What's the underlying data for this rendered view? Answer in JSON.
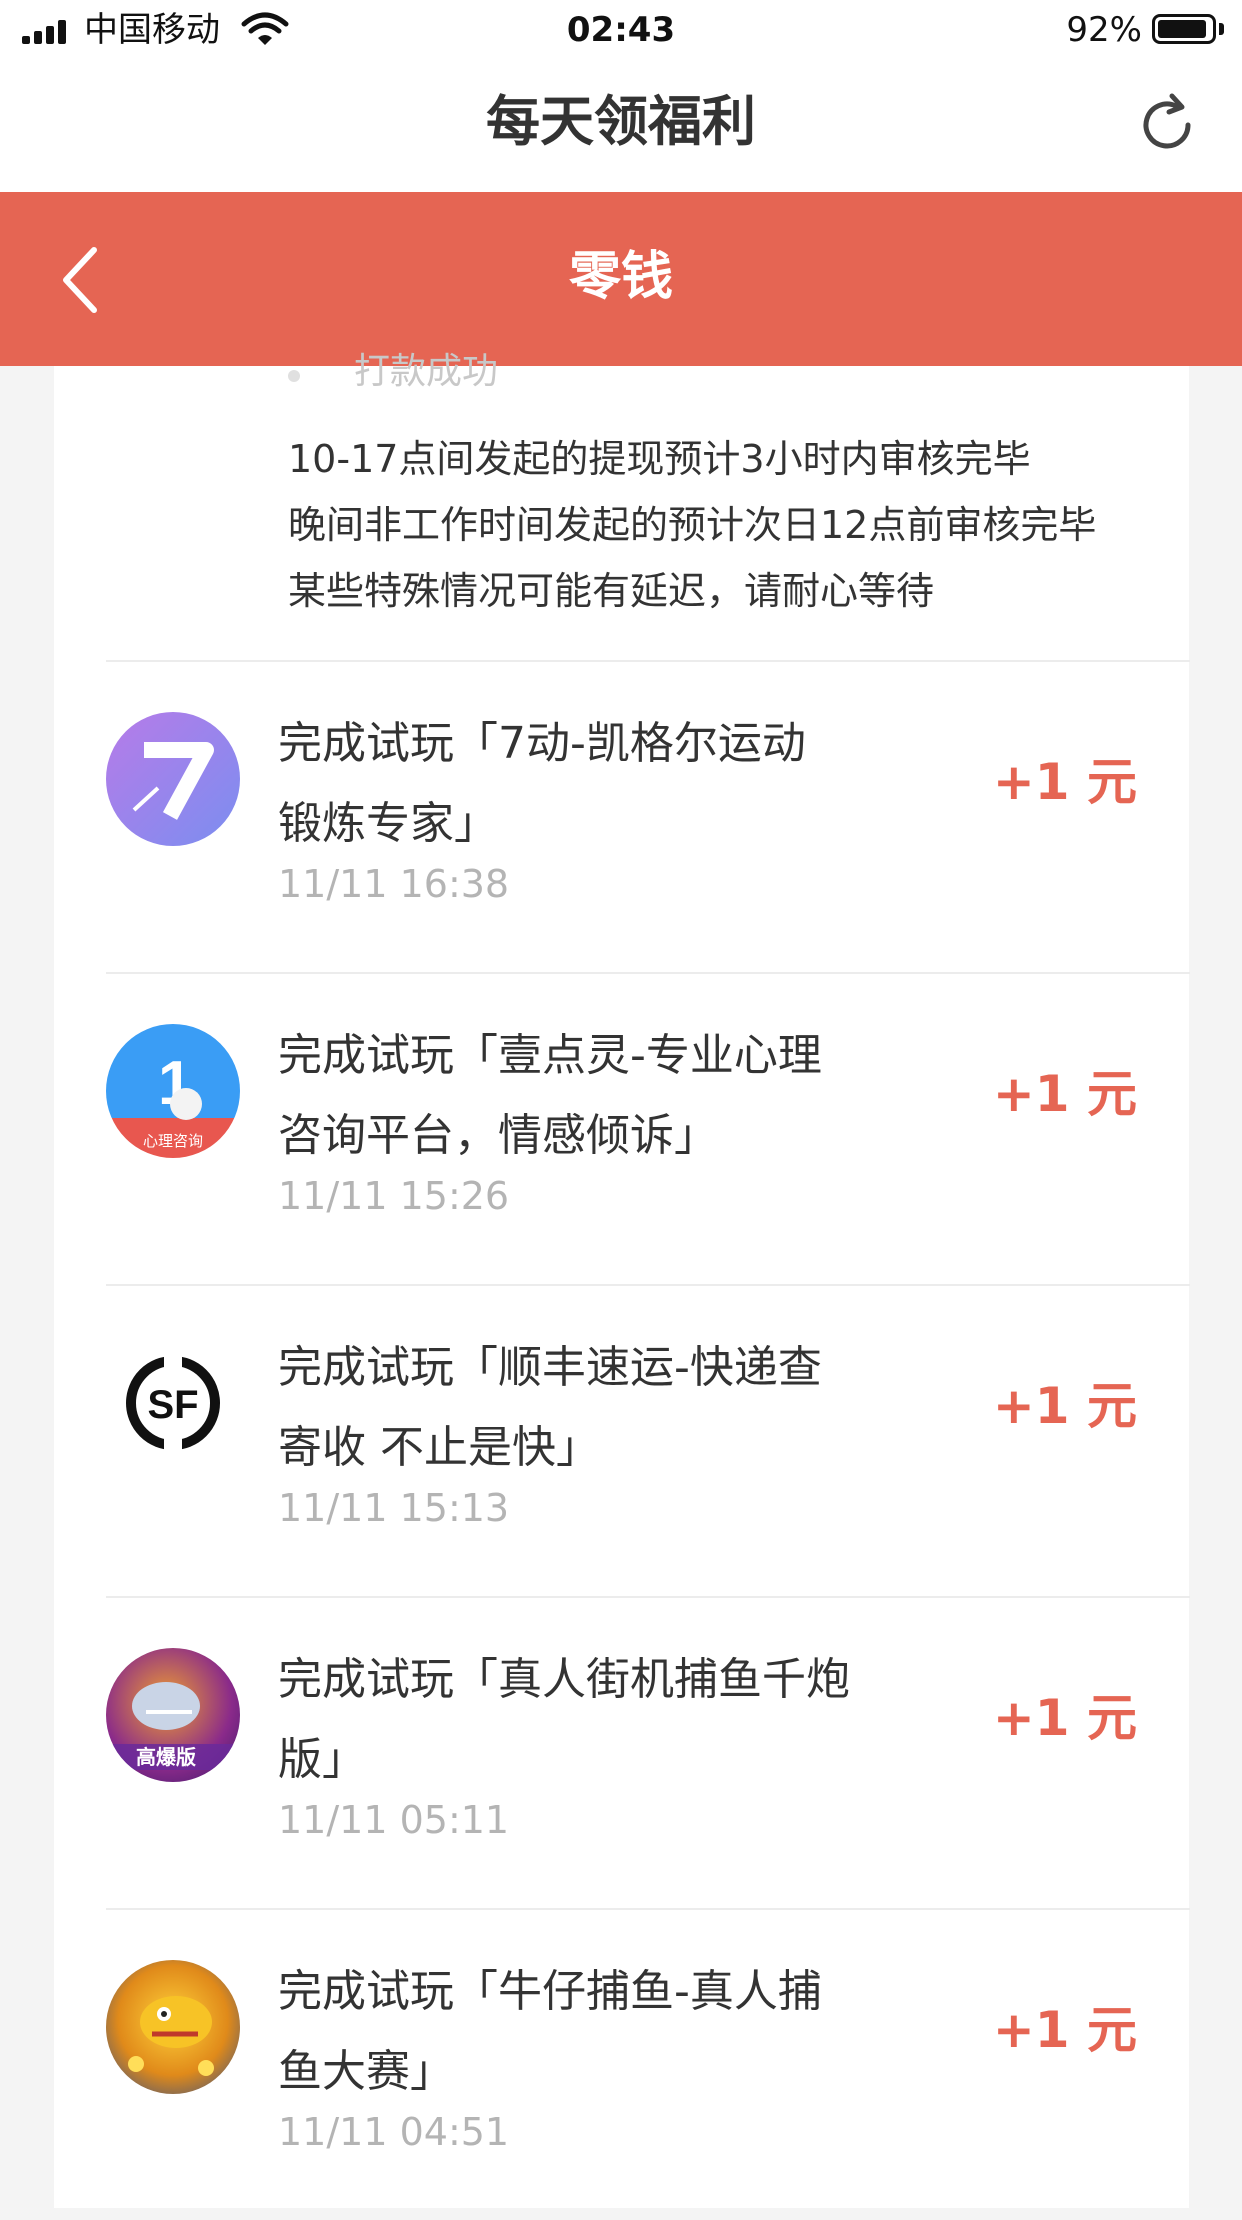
{
  "status_bar": {
    "carrier": "中国移动",
    "time": "02:43",
    "battery_percent": "92%",
    "battery_level": 0.92
  },
  "title_bar": {
    "title": "每天领福利",
    "refresh_icon": "refresh-icon"
  },
  "header": {
    "title": "零钱",
    "back_icon": "chevron-left-icon",
    "color": "#e56553"
  },
  "card": {
    "peek_text": "打款成功",
    "notes": [
      "10-17点间发起的提现预计3小时内审核完毕",
      "晚间非工作时间发起的预计次日12点前审核完毕",
      "某些特殊情况可能有延迟，请耐心等待"
    ],
    "tasks": [
      {
        "line1": "完成试玩「7动-凯格尔运动",
        "line2": "锻炼专家」",
        "time": "11/11 16:38",
        "reward": "+1 元",
        "icon": "app-7dong-icon",
        "icon_text": "7"
      },
      {
        "line1": "完成试玩「壹点灵-专业心理",
        "line2": "咨询平台，情感倾诉」",
        "time": "11/11 15:26",
        "reward": "+1 元",
        "icon": "app-yidianling-icon",
        "icon_text": "心理咨询"
      },
      {
        "line1": "完成试玩「顺丰速运-快递查",
        "line2": "寄收 不止是快」",
        "time": "11/11 15:13",
        "reward": "+1 元",
        "icon": "app-sf-icon",
        "icon_text": "SF"
      },
      {
        "line1": "完成试玩「真人街机捕鱼千炮",
        "line2": "版」",
        "time": "11/11 05:11",
        "reward": "+1 元",
        "icon": "app-fishing-icon",
        "icon_text": "高爆版"
      },
      {
        "line1": "完成试玩「牛仔捕鱼-真人捕",
        "line2": "鱼大赛」",
        "time": "11/11 04:51",
        "reward": "+1 元",
        "icon": "app-cowboy-fishing-icon",
        "icon_text": ""
      }
    ]
  },
  "colors": {
    "accent": "#e56553",
    "time_gray": "#b4b4b4",
    "text": "#333333"
  }
}
